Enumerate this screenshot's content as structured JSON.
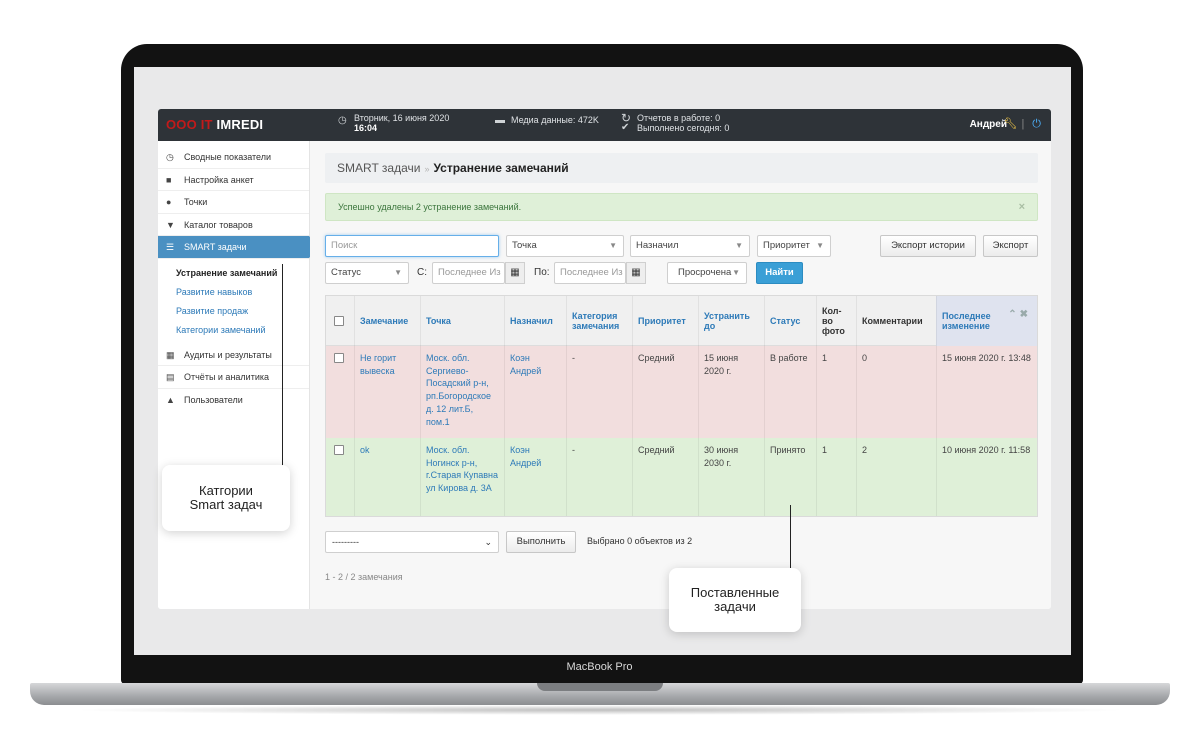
{
  "header": {
    "brand_prefix": "ООО IT",
    "brand_name": "IMREDI",
    "date": "Вторник, 16 июня 2020",
    "time": "16:04",
    "media": "Медиа данные: 472K",
    "reports_in_progress": "Отчетов в работе: 0",
    "done_today": "Выполнено сегодня: 0",
    "user": "Андрей"
  },
  "sidebar": {
    "items": [
      {
        "label": "Сводные показатели",
        "icon": "dashboard-icon"
      },
      {
        "label": "Настройка анкет",
        "icon": "file-icon"
      },
      {
        "label": "Точки",
        "icon": "globe-icon"
      },
      {
        "label": "Каталог товаров",
        "icon": "cart-icon"
      },
      {
        "label": "SMART задачи",
        "icon": "list-icon"
      },
      {
        "label": "Аудиты и результаты",
        "icon": "calendar-icon"
      },
      {
        "label": "Отчёты и аналитика",
        "icon": "report-icon"
      },
      {
        "label": "Пользователи",
        "icon": "user-icon"
      }
    ],
    "sub_items": [
      "Устранение замечаний",
      "Развитие навыков",
      "Развитие продаж",
      "Категории замечаний"
    ]
  },
  "breadcrumb": {
    "parent": "SMART задачи",
    "sep": "»",
    "current": "Устранение замечаний"
  },
  "alert": {
    "text": "Успешно удалены 2 устранение замечаний.",
    "close": "×"
  },
  "filters": {
    "search_placeholder": "Поиск",
    "point": "Точка",
    "assigned": "Назначил",
    "priority": "Приоритет",
    "export_history": "Экспорт истории",
    "export": "Экспорт",
    "status": "Статус",
    "from_label": "С:",
    "from_placeholder": "Последнее Из",
    "to_label": "По:",
    "to_placeholder": "Последнее Из",
    "overdue": "Просрочена",
    "find": "Найти"
  },
  "table": {
    "headers": [
      "Замечание",
      "Точка",
      "Назначил",
      "Категория замечания",
      "Приоритет",
      "Устранить до",
      "Статус",
      "Кол-во фото",
      "Комментарии",
      "Последнее изменение"
    ],
    "rows": [
      {
        "remark": "Не горит вывеска",
        "point": "Моск. обл. Сергиево-Посадский р-н, рп.Богородское д. 12 лит.Б, пом.1",
        "assigned": "Коэн Андрей",
        "category": "-",
        "priority": "Средний",
        "due": "15 июня 2020 г.",
        "status": "В работе",
        "photos": "1",
        "comments": "0",
        "changed": "15 июня 2020 г. 13:48"
      },
      {
        "remark": "ok",
        "point": "Моск. обл. Ногинск р-н, г.Старая Купавна ул Кирова д. 3А",
        "assigned": "Коэн Андрей",
        "category": "-",
        "priority": "Средний",
        "due": "30 июня 2030 г.",
        "status": "Принято",
        "photos": "1",
        "comments": "2",
        "changed": "10 июня 2020 г. 11:58"
      }
    ]
  },
  "actions": {
    "select_value": "---------",
    "run": "Выполнить",
    "selected_info": "Выбрано 0 объектов из 2"
  },
  "paginator": "1 - 2  /  2 замечания",
  "callouts": {
    "left": "Катгории\nSmart задач",
    "right": "Поставленные\nзадачи"
  },
  "device_label": "MacBook Pro"
}
